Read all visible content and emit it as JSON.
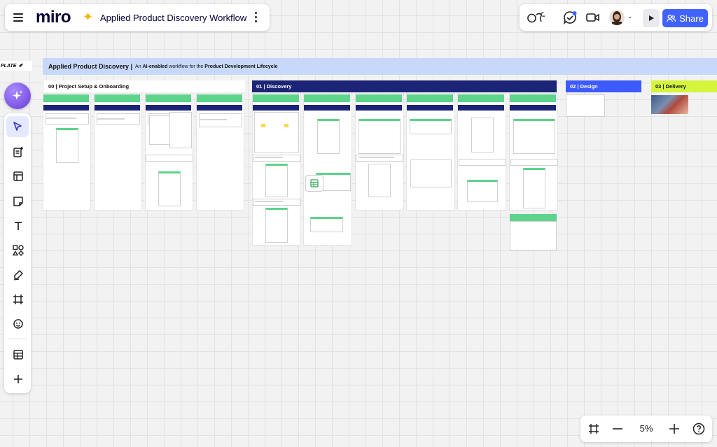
{
  "app": {
    "logo": "miro",
    "board_title": "Applied Product Discovery Workflow",
    "share_label": "Share"
  },
  "toolbar_icons": [
    "reactions-icon",
    "comments-icon",
    "video-call-icon",
    "avatar",
    "present-icon"
  ],
  "sidebar": {
    "items": [
      "ai-assist-icon",
      "select-icon",
      "templates-icon",
      "layout-icon",
      "sticky-note-icon",
      "text-icon",
      "shapes-icon",
      "pen-icon",
      "frame-icon",
      "stickers-icon",
      "table-icon",
      "add-icon"
    ]
  },
  "board": {
    "template_tag": "PLATE",
    "banner_title": "Applied Product Discovery |",
    "banner_sub_pre": "An ",
    "banner_sub_bold1": "AI-enabled",
    "banner_sub_mid": " workflow for the ",
    "banner_sub_bold2": "Product Development Lifecycle",
    "sections": [
      {
        "label": "00 | Project Setup & Onboarding"
      },
      {
        "label": "01 | Discovery"
      },
      {
        "label": "02 | Design"
      },
      {
        "label": "03 | Delivery"
      }
    ]
  },
  "zoom": {
    "value": "5%"
  },
  "colors": {
    "brand": "#4262ff",
    "banner": "#c8d8fb",
    "navy": "#1c2477",
    "green": "#5ed38c",
    "design": "#3d5afe",
    "delivery": "#d4f53c"
  }
}
